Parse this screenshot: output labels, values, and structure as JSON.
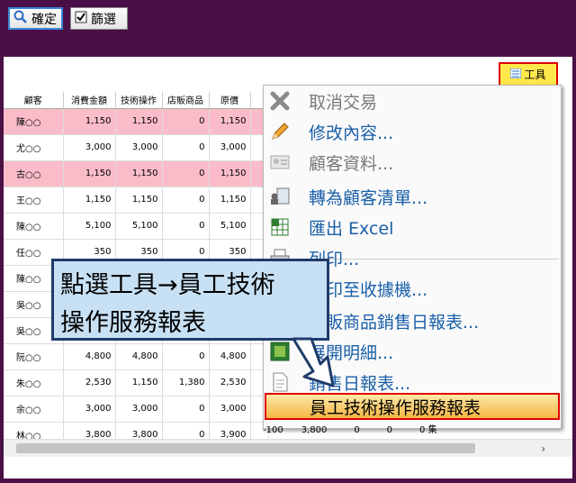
{
  "toolbar": {
    "confirm_label": "確定",
    "filter_label": "篩選"
  },
  "tools_button": {
    "label": "工具"
  },
  "table": {
    "headers": [
      "顧客",
      "消費金額",
      "技術操作",
      "店販商品",
      "原價",
      ""
    ],
    "rows": [
      {
        "name": "陳○○",
        "amount": "1,150",
        "tech": "1,150",
        "retail": "0",
        "orig": "1,150"
      },
      {
        "name": "尤○○",
        "amount": "3,000",
        "tech": "3,000",
        "retail": "0",
        "orig": "3,000"
      },
      {
        "name": "古○○",
        "amount": "1,150",
        "tech": "1,150",
        "retail": "0",
        "orig": "1,150"
      },
      {
        "name": "王○○",
        "amount": "1,150",
        "tech": "1,150",
        "retail": "0",
        "orig": "1,150"
      },
      {
        "name": "陳○○",
        "amount": "5,100",
        "tech": "5,100",
        "retail": "0",
        "orig": "5,100"
      },
      {
        "name": "任○○",
        "amount": "350",
        "tech": "350",
        "retail": "0",
        "orig": "350"
      },
      {
        "name": "陳○○",
        "amount": "",
        "tech": "",
        "retail": "",
        "orig": ""
      },
      {
        "name": "吳○○",
        "amount": "",
        "tech": "",
        "retail": "",
        "orig": ""
      },
      {
        "name": "吳○○",
        "amount": "",
        "tech": "",
        "retail": "",
        "orig": ""
      },
      {
        "name": "阮○○",
        "amount": "4,800",
        "tech": "4,800",
        "retail": "0",
        "orig": "4,800"
      },
      {
        "name": "朱○○",
        "amount": "2,530",
        "tech": "1,150",
        "retail": "1,380",
        "orig": "2,530"
      },
      {
        "name": "余○○",
        "amount": "3,000",
        "tech": "3,000",
        "retail": "0",
        "orig": "3,000"
      },
      {
        "name": "林○○",
        "amount": "3,800",
        "tech": "3,800",
        "retail": "0",
        "orig": "3,900"
      }
    ],
    "last_row_tail": "-100　　3,800　　　0　　　0　　　0 集"
  },
  "menu": {
    "items": [
      {
        "label": "取消交易",
        "icon": "cancel-x-icon",
        "disabled": true
      },
      {
        "label": "修改內容...",
        "icon": "pencil-icon",
        "disabled": false
      },
      {
        "label": "顧客資料...",
        "icon": "customer-card-icon",
        "disabled": true
      },
      {
        "label": "轉為顧客清單...",
        "icon": "people-list-icon",
        "disabled": false
      },
      {
        "label": "匯出 Excel",
        "icon": "excel-icon",
        "disabled": false
      },
      {
        "label": "列印...",
        "icon": "printer-icon",
        "disabled": false
      },
      {
        "label": "列印至收據機...",
        "icon": "receipt-printer-icon",
        "disabled": false
      },
      {
        "label": "店販商品銷售日報表...",
        "icon": "report-icon",
        "disabled": false
      },
      {
        "label": "展開明細...",
        "icon": "expand-icon",
        "disabled": false
      },
      {
        "label": "銷售日報表...",
        "icon": "document-icon",
        "disabled": false
      },
      {
        "label": "員工技術操作服務報表",
        "icon": "",
        "disabled": false
      }
    ]
  },
  "callout": {
    "line1": "點選工具→員工技術",
    "line2": "操作服務報表"
  },
  "colors": {
    "background": "#4b0f47",
    "highlight_border": "#e00000",
    "pink_row": "#fbbcc9",
    "menu_text": "#1a5fa8",
    "callout_bg": "#c7e0f4"
  }
}
